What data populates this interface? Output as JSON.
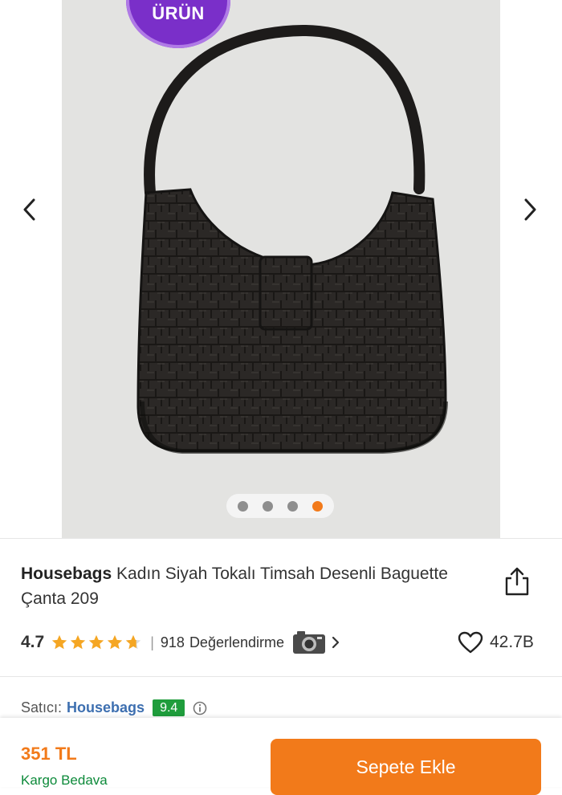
{
  "gallery": {
    "badge_text": "ÜRÜN",
    "image_alt": "Kadın Siyah Tokalı Timsah Desenli Baguette Çanta",
    "image_count": 4,
    "active_image": 4
  },
  "product": {
    "brand": "Housebags",
    "name": "Kadın Siyah Tokalı Timsah Desenli Baguette Çanta 209"
  },
  "rating": {
    "score": "4.7",
    "stars": 4.7,
    "separator": "|",
    "count": "918",
    "label": "Değerlendirme",
    "chevron": "›"
  },
  "favorite": {
    "count": "42.7B"
  },
  "seller": {
    "label": "Satıcı:",
    "name": "Housebags",
    "score": "9.4"
  },
  "purchase": {
    "price": "351 TL",
    "shipping": "Kargo Bedava",
    "cart_label": "Sepete Ekle"
  },
  "colors": {
    "accent": "#f27a1a",
    "badge": "#7a2fc9",
    "seller_score": "#1f9d3c",
    "link": "#3d6fb0",
    "shipping": "#0d8a3a"
  }
}
